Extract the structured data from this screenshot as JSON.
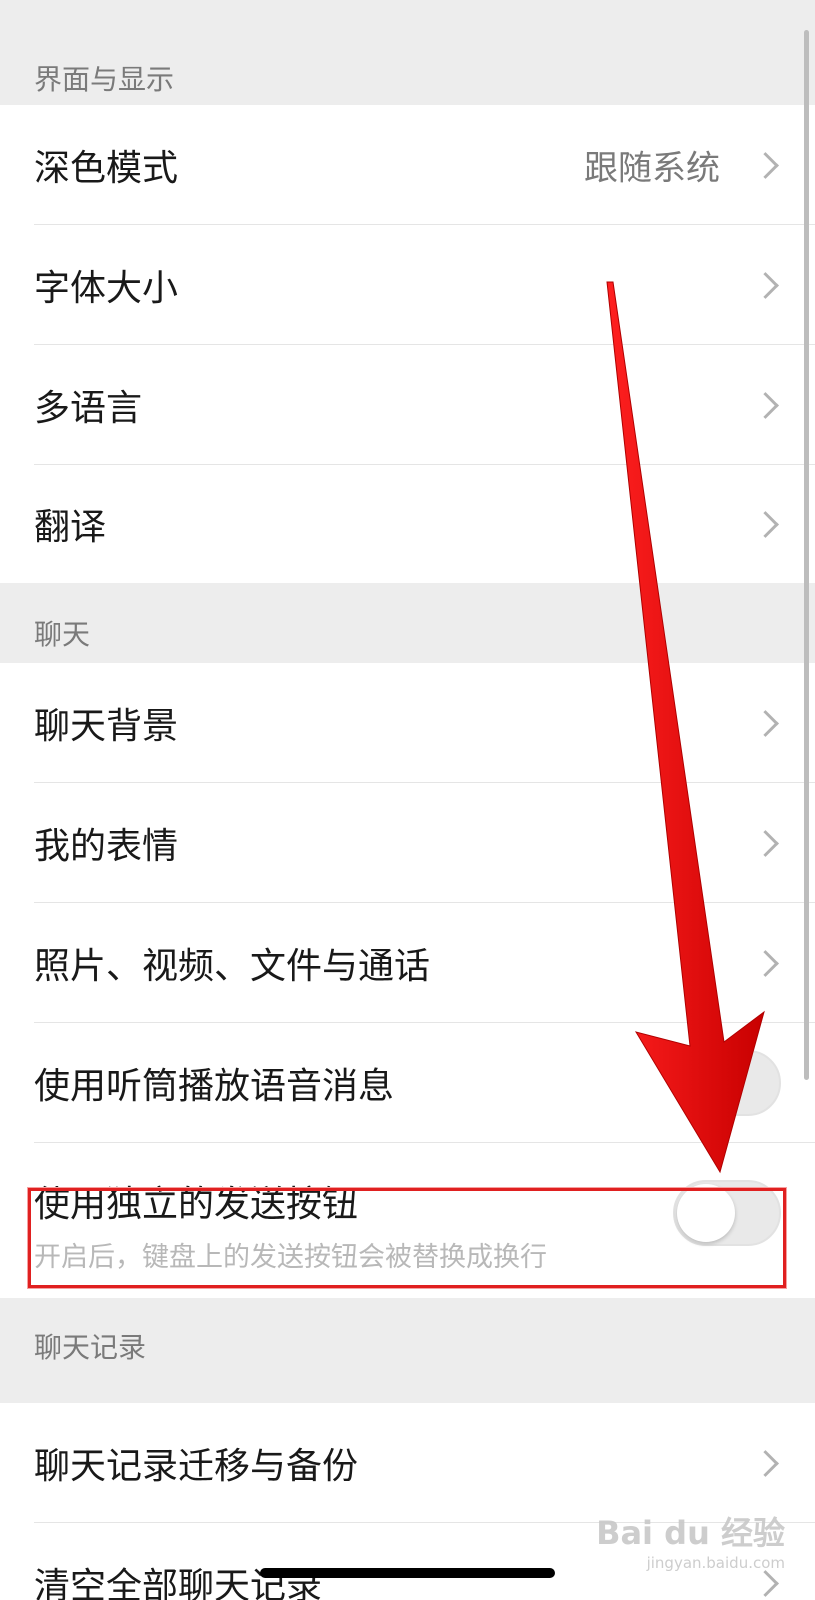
{
  "sections": {
    "display": {
      "header": "界面与显示"
    },
    "chat": {
      "header": "聊天"
    },
    "history": {
      "header": "聊天记录"
    }
  },
  "rows": {
    "dark_mode": {
      "label": "深色模式",
      "value": "跟随系统"
    },
    "font_size": {
      "label": "字体大小"
    },
    "language": {
      "label": "多语言"
    },
    "translate": {
      "label": "翻译"
    },
    "chat_bg": {
      "label": "聊天背景"
    },
    "stickers": {
      "label": "我的表情"
    },
    "media": {
      "label": "照片、视频、文件与通话"
    },
    "earpiece": {
      "label": "使用听筒播放语音消息",
      "enabled": false
    },
    "send_button": {
      "label": "使用独立的发送按钮",
      "sub": "开启后，键盘上的发送按钮会被替换成换行",
      "enabled": false
    },
    "migrate": {
      "label": "聊天记录迁移与备份"
    },
    "clear": {
      "label": "清空全部聊天记录"
    }
  },
  "watermark": {
    "main": "Bai du 经验",
    "sub": "jingyan.baidu.com"
  },
  "colors": {
    "arrow": "#e00000",
    "highlight": "#e02020",
    "background": "#ededed"
  }
}
